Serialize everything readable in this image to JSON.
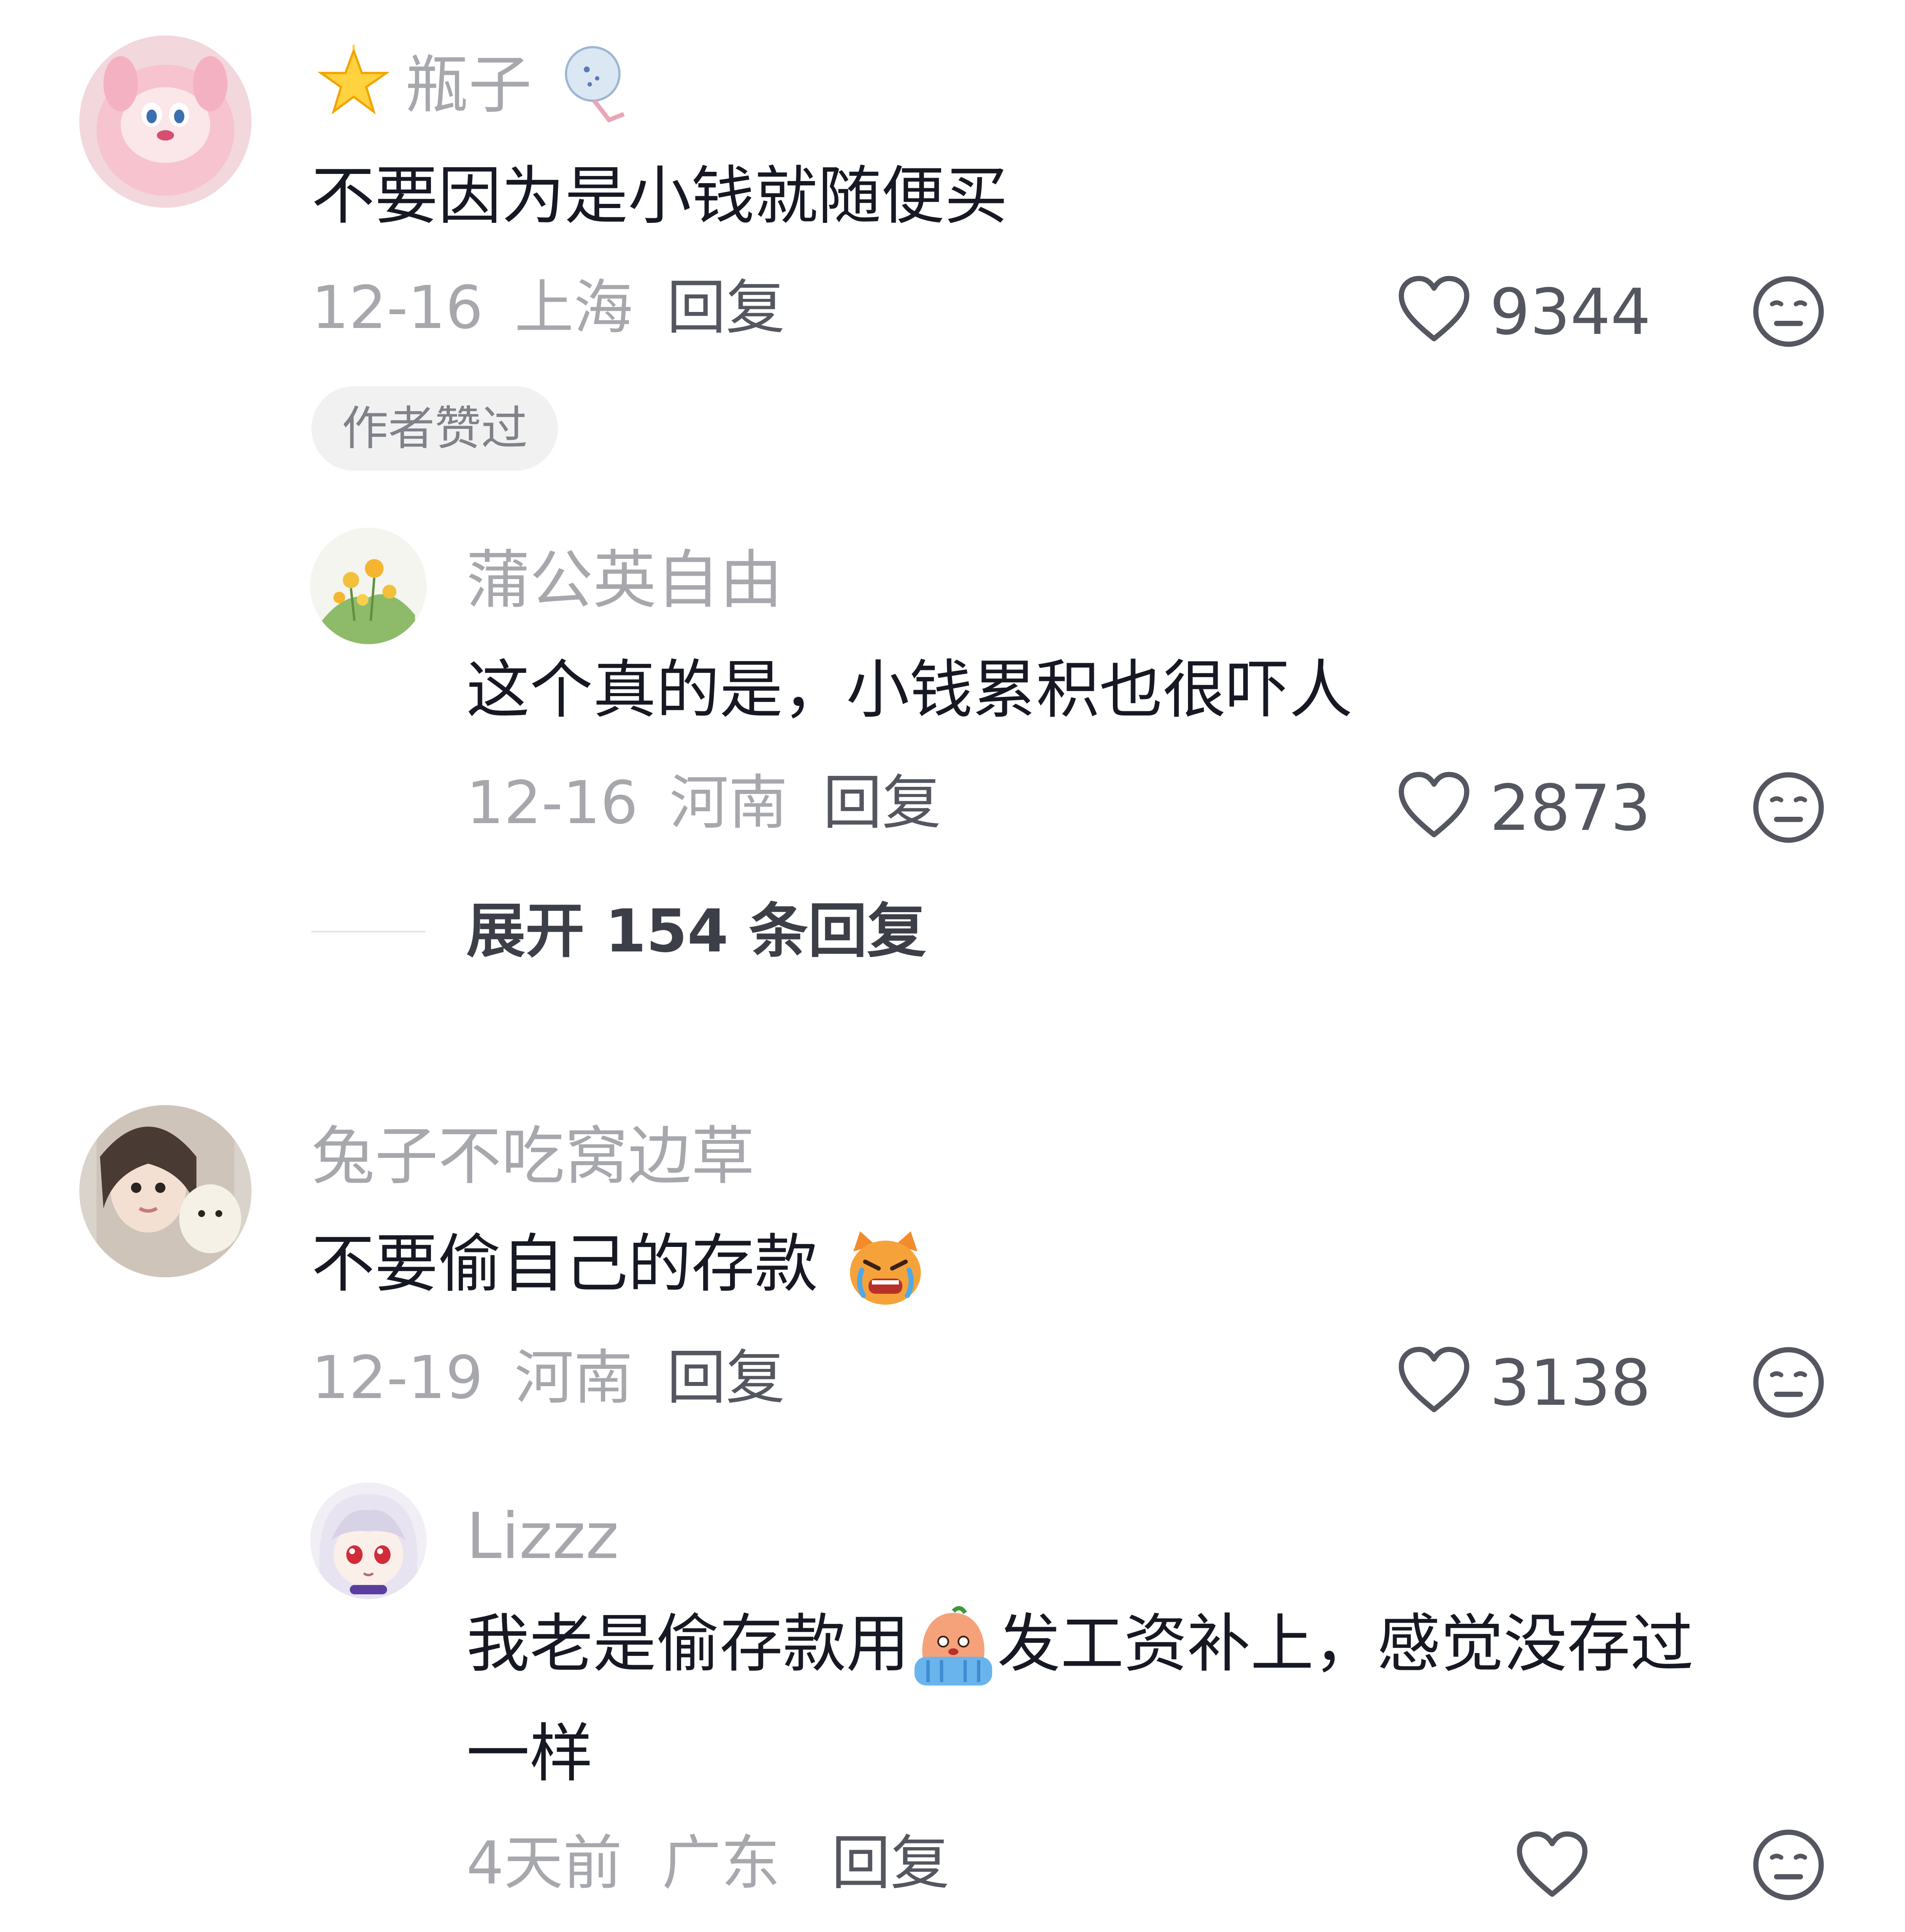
{
  "colors": {
    "primary_text": "#161823",
    "secondary_text": "#a7a8ad",
    "action_text": "#545660",
    "tag_bg": "#f1f1f2",
    "icon_stroke": "#545660"
  },
  "comments": [
    {
      "username": "瓶子",
      "content": "不要因为是小钱就随便买",
      "date": "12-16",
      "location": "上海",
      "reply_label": "回复",
      "likes": "9344",
      "tag": "作者赞过",
      "reply": {
        "username": "蒲公英自由",
        "content": "这个真的是，小钱累积也很吓人",
        "date": "12-16",
        "location": "河南",
        "reply_label": "回复",
        "likes": "2873"
      },
      "expand_label": "展开 154 条回复"
    },
    {
      "username": "兔子不吃窝边草",
      "content": "不要偷自己的存款",
      "date": "12-19",
      "location": "河南",
      "reply_label": "回复",
      "likes": "3138",
      "reply": {
        "username": "Lizzz",
        "content_part1": "我老是偷存款用",
        "content_part2": "发工资补上，感觉没存过",
        "content_line2": "一样",
        "date": "4天前",
        "location": "广东",
        "reply_label": "回复"
      }
    }
  ],
  "icons": {
    "like": "heart-outline-icon",
    "dislike": "neutral-face-icon",
    "star_badge": "star-badge-icon",
    "bottle_badge": "bottle-badge-icon",
    "cat_emoji": "crying-angry-cat-emoji",
    "tears_emoji": "crying-tears-emoji"
  }
}
